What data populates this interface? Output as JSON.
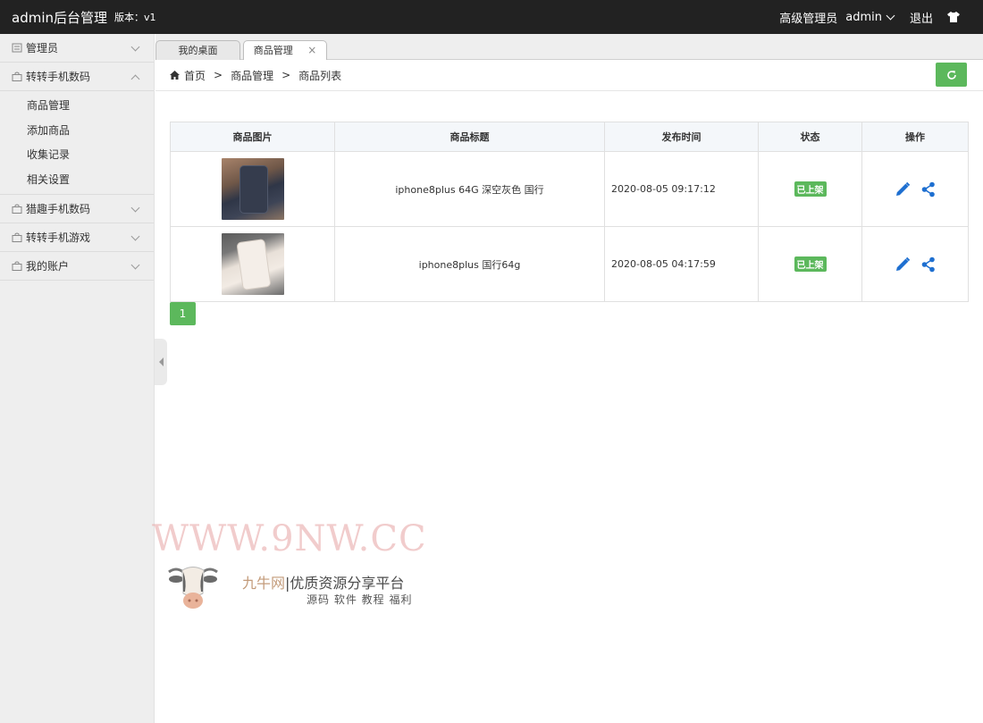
{
  "header": {
    "brand": "admin后台管理",
    "version": "版本：v1",
    "role": "高级管理员",
    "user": "admin",
    "logout": "退出"
  },
  "sidebar": {
    "menus": [
      {
        "label": "管理员",
        "icon": "list-icon",
        "expanded": false
      },
      {
        "label": "转转手机数码",
        "icon": "bag-icon",
        "expanded": true,
        "items": [
          "商品管理",
          "添加商品",
          "收集记录",
          "相关设置"
        ]
      },
      {
        "label": "猎趣手机数码",
        "icon": "bag-icon",
        "expanded": false
      },
      {
        "label": "转转手机游戏",
        "icon": "bag-icon",
        "expanded": false
      },
      {
        "label": "我的账户",
        "icon": "bag-icon",
        "expanded": false
      }
    ]
  },
  "tabs": [
    {
      "label": "我的桌面"
    },
    {
      "label": "商品管理",
      "close": "×"
    }
  ],
  "breadcrumb": [
    "首页",
    "商品管理",
    "商品列表"
  ],
  "breadcrumb_sep": ">",
  "table": {
    "columns": [
      "商品图片",
      "商品标题",
      "发布时间",
      "状态",
      "操作"
    ],
    "rows": [
      {
        "title": "iphone8plus 64G 深空灰色 国行",
        "time": "2020-08-05 09:17:12",
        "status": "已上架",
        "image": "dark-phone-thumb"
      },
      {
        "title": "iphone8plus 国行64g",
        "time": "2020-08-05 04:17:59",
        "status": "已上架",
        "image": "light-phone-thumb"
      }
    ]
  },
  "pagination": {
    "current": "1"
  },
  "watermark": {
    "url": "WWW.9NW.CC",
    "title_accent": "九牛网",
    "title_sep": "|",
    "title": "优质资源分享平台",
    "subtitle": "源码 软件 教程 福利"
  },
  "colors": {
    "header_bg": "#222222",
    "primary_green": "#5cb85c",
    "icon_blue": "#1e6fd0",
    "sidebar_bg": "#eeeeee"
  }
}
